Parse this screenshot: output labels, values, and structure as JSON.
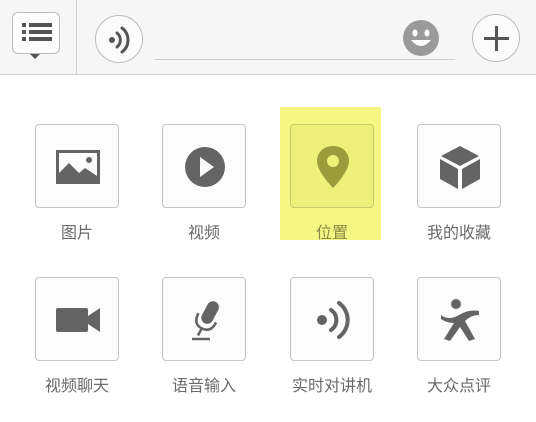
{
  "toolbar": {
    "menu_icon": "list-menu-icon",
    "voice_icon": "voice-waves-icon",
    "input_value": "",
    "input_placeholder": "",
    "emoji_icon": "smiley-face-icon",
    "plus_icon": "plus-icon"
  },
  "panel": {
    "items": [
      {
        "label": "图片",
        "icon": "image-icon"
      },
      {
        "label": "视频",
        "icon": "play-icon"
      },
      {
        "label": "位置",
        "icon": "location-pin-icon",
        "highlighted": true
      },
      {
        "label": "我的收藏",
        "icon": "cube-icon"
      },
      {
        "label": "视频聊天",
        "icon": "video-camera-icon"
      },
      {
        "label": "语音输入",
        "icon": "microphone-icon"
      },
      {
        "label": "实时对讲机",
        "icon": "walkie-talkie-icon"
      },
      {
        "label": "大众点评",
        "icon": "dianping-icon"
      }
    ]
  },
  "colors": {
    "icon": "#646464",
    "highlight": "#f6f684",
    "highlight_icon": "#9c9c3c"
  }
}
